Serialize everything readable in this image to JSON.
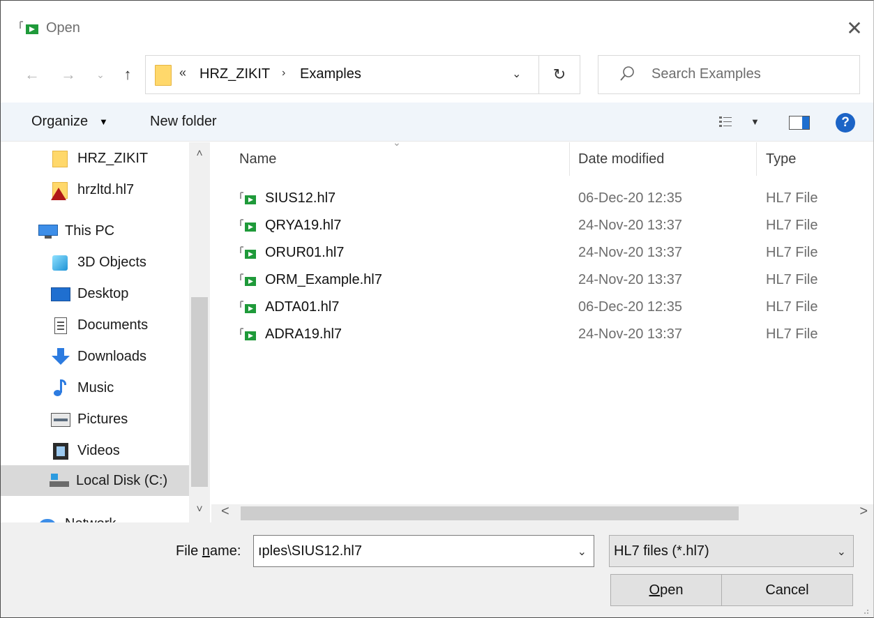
{
  "window": {
    "title": "Open",
    "close_glyph": "✕"
  },
  "nav": {
    "back_glyph": "←",
    "forward_glyph": "→",
    "recent_glyph": "⌄",
    "up_glyph": "↑",
    "breadcrumb_prefix": "«",
    "breadcrumb": [
      "HRZ_ZIKIT",
      "Examples"
    ],
    "breadcrumb_sep": "›",
    "dropdown_glyph": "⌄",
    "refresh_glyph": "↻"
  },
  "search": {
    "placeholder": "Search Examples"
  },
  "toolbar": {
    "organize_label": "Organize",
    "organize_caret": "▼",
    "new_folder_label": "New folder",
    "view_caret": "▼",
    "help_label": "?"
  },
  "sidebar": {
    "items": [
      {
        "label": "HRZ_ZIKIT",
        "icon": "folder-icon"
      },
      {
        "label": "hrzltd.hl7",
        "icon": "hl7-app-icon"
      },
      {
        "label": "This PC",
        "icon": "computer-icon"
      },
      {
        "label": "3D Objects",
        "icon": "3d-objects-icon"
      },
      {
        "label": "Desktop",
        "icon": "desktop-icon"
      },
      {
        "label": "Documents",
        "icon": "documents-icon"
      },
      {
        "label": "Downloads",
        "icon": "downloads-icon"
      },
      {
        "label": "Music",
        "icon": "music-icon"
      },
      {
        "label": "Pictures",
        "icon": "pictures-icon"
      },
      {
        "label": "Videos",
        "icon": "videos-icon"
      },
      {
        "label": "Local Disk (C:)",
        "icon": "local-disk-icon"
      },
      {
        "label": "Network",
        "icon": "network-icon"
      }
    ],
    "selected": "Local Disk (C:)",
    "scroll_up_glyph": "˄",
    "scroll_down_glyph": "˅"
  },
  "filelist": {
    "columns": [
      "Name",
      "Date modified",
      "Type"
    ],
    "sort_glyph": "⌄",
    "rows": [
      {
        "name": "SIUS12.hl7",
        "date": "06-Dec-20 12:35",
        "type": "HL7 File"
      },
      {
        "name": "QRYA19.hl7",
        "date": "24-Nov-20 13:37",
        "type": "HL7 File"
      },
      {
        "name": "ORUR01.hl7",
        "date": "24-Nov-20 13:37",
        "type": "HL7 File"
      },
      {
        "name": "ORM_Example.hl7",
        "date": "24-Nov-20 13:37",
        "type": "HL7 File"
      },
      {
        "name": "ADTA01.hl7",
        "date": "06-Dec-20 12:35",
        "type": "HL7 File"
      },
      {
        "name": "ADRA19.hl7",
        "date": "24-Nov-20 13:37",
        "type": "HL7 File"
      }
    ],
    "scroll_left_glyph": "<",
    "scroll_right_glyph": ">"
  },
  "footer": {
    "file_name_label_pre": "File ",
    "file_name_label_u": "n",
    "file_name_label_post": "ame:",
    "file_name_value": "ıples\\SIUS12.hl7",
    "file_name_drop_glyph": "⌄",
    "filter_value": "HL7 files (*.hl7)",
    "filter_drop_glyph": "⌄",
    "open_label_u": "O",
    "open_label_rest": "pen",
    "cancel_label": "Cancel"
  }
}
